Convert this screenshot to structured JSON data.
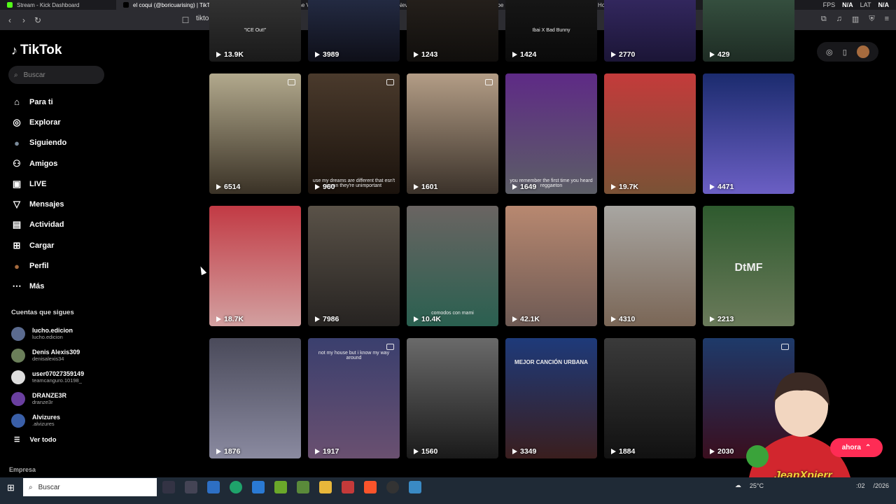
{
  "browser": {
    "tabs": [
      {
        "title": "Stream - Kick Dashboard",
        "color": "#53fc18"
      },
      {
        "title": "el coqui (@boricuarising) | TikTok",
        "color": "#000000",
        "active": true
      },
      {
        "title": "Runnation - Watch the VOD on Kick",
        "color": "#53fc18"
      },
      {
        "title": "Bad Bunny - Neverita (Video Oficial)",
        "color": "#ff0000"
      },
      {
        "title": "YouTube",
        "color": "#ff0000"
      },
      {
        "title": "Home / X",
        "color": "#000000"
      }
    ],
    "fps_label": "FPS",
    "fps_value": "N/A",
    "lat_label": "LAT",
    "lat_value": "N/A",
    "url": "tiktok.com/@boricuarising"
  },
  "sidebar": {
    "logo": "TikTok",
    "search_placeholder": "Buscar",
    "nav": [
      {
        "label": "Para ti",
        "icon": "home-icon"
      },
      {
        "label": "Explorar",
        "icon": "compass-icon"
      },
      {
        "label": "Siguiendo",
        "icon": "following-avatar-icon"
      },
      {
        "label": "Amigos",
        "icon": "friends-icon"
      },
      {
        "label": "LIVE",
        "icon": "live-icon"
      },
      {
        "label": "Mensajes",
        "icon": "messages-icon"
      },
      {
        "label": "Actividad",
        "icon": "activity-icon"
      },
      {
        "label": "Cargar",
        "icon": "upload-icon"
      },
      {
        "label": "Perfil",
        "icon": "profile-avatar-icon"
      },
      {
        "label": "Más",
        "icon": "more-icon"
      }
    ],
    "following_header": "Cuentas que sigues",
    "following": [
      {
        "name": "lucho.edicion",
        "user": "lucho.edicion",
        "color": "#5b6b8f"
      },
      {
        "name": "Denis Alexis309",
        "user": "denisalexis34",
        "color": "#6b7f5a"
      },
      {
        "name": "user07027359149",
        "user": "teamcanguro.10198_",
        "color": "#dddddd"
      },
      {
        "name": "DRANZE3R",
        "user": "dranze3r",
        "color": "#6a3fa0"
      },
      {
        "name": "Alvizures",
        "user": ".alvizures",
        "color": "#3a5fa8"
      }
    ],
    "see_all": "Ver todo",
    "company": "Empresa"
  },
  "videos": [
    {
      "views": "13.9K",
      "caption": "\"ICE Out!\"",
      "bg": "linear-gradient(#3a3a3a,#1a1a1a)"
    },
    {
      "views": "3989",
      "caption": "",
      "bg": "linear-gradient(#2a3350,#0e0f18)"
    },
    {
      "views": "1243",
      "caption": "",
      "bg": "linear-gradient(#2b2520,#100e0c)"
    },
    {
      "views": "1424",
      "caption": "Ibai X Bad Bunny",
      "bg": "linear-gradient(#1a1a1a,#0a0a0a)"
    },
    {
      "views": "2770",
      "caption": "",
      "bg": "linear-gradient(#3a2d6b,#1b1536)"
    },
    {
      "views": "429",
      "caption": "",
      "bg": "linear-gradient(#3c5a47,#1e2c24)"
    },
    {
      "views": "6514",
      "caption": "",
      "bg": "linear-gradient(#b2a98d,#3a3226)",
      "multi": true
    },
    {
      "views": "960",
      "caption": "use my dreams are different that esn't mean they're unimportant",
      "bg": "linear-gradient(#4a3a2c,#1a120c)",
      "multi": true
    },
    {
      "views": "1601",
      "caption": "",
      "bg": "linear-gradient(#b39d86,#3b322a)",
      "multi": true
    },
    {
      "views": "1649",
      "caption": "you remember the first time you heard reggaeton",
      "bg": "linear-gradient(#5e2a86,#5c5e66)"
    },
    {
      "views": "19.7K",
      "caption": "",
      "bg": "linear-gradient(#c43b3b,#7a5236)"
    },
    {
      "views": "4471",
      "caption": "",
      "bg": "linear-gradient(#1b2b6e,#6b5fc4)"
    },
    {
      "views": "18.7K",
      "caption": "",
      "bg": "linear-gradient(#c23a44,#d2a0a0)"
    },
    {
      "views": "7986",
      "caption": "",
      "bg": "linear-gradient(#5a5248,#262321)"
    },
    {
      "views": "10.4K",
      "caption": "comodos con mami",
      "bg": "linear-gradient(#6a6462,#2a6050)"
    },
    {
      "views": "42.1K",
      "caption": "",
      "bg": "linear-gradient(#b88870,#6e5a54)"
    },
    {
      "views": "4310",
      "caption": "",
      "bg": "linear-gradient(#a8a6a2,#7a6656)"
    },
    {
      "views": "2213",
      "caption": "DtMF",
      "bg": "linear-gradient(#2e5a2e,#6a7a5a)"
    },
    {
      "views": "1876",
      "caption": "",
      "bg": "linear-gradient(#4a4a5a,#8a8aa0)"
    },
    {
      "views": "1917",
      "caption": "not my house but i know my way around",
      "bg": "linear-gradient(#3a3f6e,#6a5070)",
      "multi": true
    },
    {
      "views": "1560",
      "caption": "",
      "bg": "linear-gradient(#6a6a6a,#1a1a1a)"
    },
    {
      "views": "3349",
      "caption": "MEJOR CANCIÓN URBANA",
      "bg": "linear-gradient(#1e3a7a,#3a1e1e)"
    },
    {
      "views": "1884",
      "caption": "",
      "bg": "linear-gradient(#3a3a3a,#111111)"
    },
    {
      "views": "2030",
      "caption": "",
      "bg": "linear-gradient(#1e3a6a,#3a0e1e)",
      "multi": true
    }
  ],
  "live_pill": "ahora",
  "streamer_name": "JeanXpierr",
  "taskbar": {
    "search_placeholder": "Buscar",
    "temperature": "25°C",
    "time": ":02",
    "date": "/2026"
  }
}
